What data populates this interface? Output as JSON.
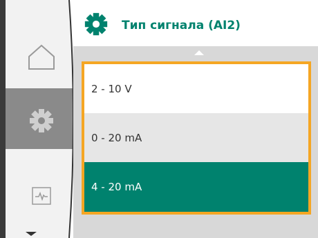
{
  "colors": {
    "accent": "#00826e",
    "selection_frame": "#f5a623",
    "list_bg": "#d8d8d8",
    "rail": "#3a3a3a"
  },
  "nav": {
    "items": [
      {
        "icon": "home-icon",
        "active": false
      },
      {
        "icon": "gear-icon",
        "active": true
      },
      {
        "icon": "diagnostics-icon",
        "active": false
      }
    ]
  },
  "header": {
    "icon": "gear-icon",
    "title": "Тип сигнала (AI2)"
  },
  "options": [
    {
      "label": "2 - 10 V",
      "state": "normal"
    },
    {
      "label": "0 - 20 mA",
      "state": "normal"
    },
    {
      "label": "4 - 20 mA",
      "state": "selected"
    }
  ]
}
